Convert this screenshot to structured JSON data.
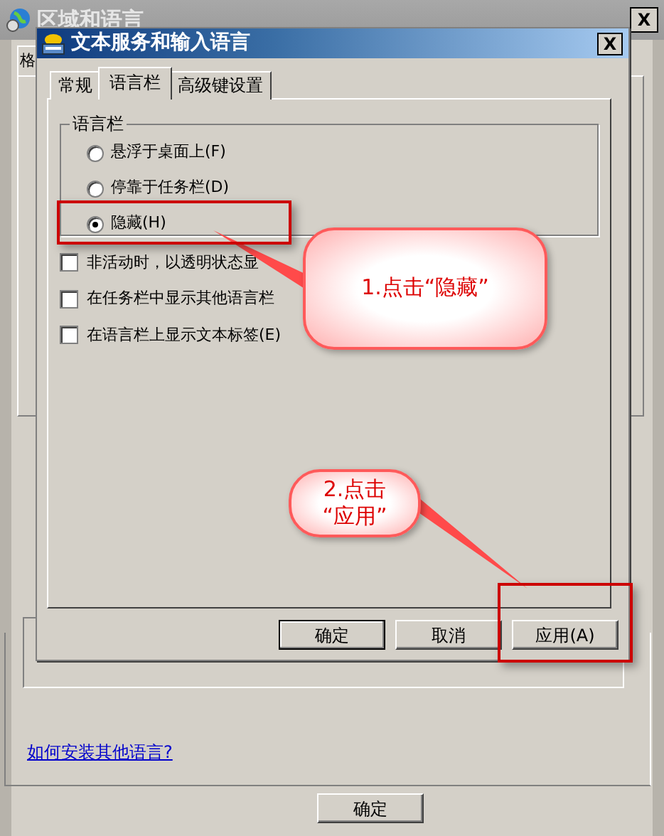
{
  "back_window": {
    "title": "区域和语言",
    "close": "X",
    "tab_fragment": "格",
    "link": "如何安装其他语言?",
    "buttons": [
      {
        "label": "确定"
      }
    ]
  },
  "dialog": {
    "title": "文本服务和输入语言",
    "close": "X",
    "tabs": [
      {
        "label": "常规",
        "selected": false
      },
      {
        "label": "语言栏",
        "selected": true
      },
      {
        "label": "高级键设置",
        "selected": false
      }
    ],
    "group": {
      "title": "语言栏",
      "options": [
        {
          "label": "悬浮于桌面上(F)",
          "selected": false
        },
        {
          "label": "停靠于任务栏(D)",
          "selected": false
        },
        {
          "label": "隐藏(H)",
          "selected": true
        }
      ]
    },
    "checkboxes": [
      {
        "label": "非活动时，以透明状态显",
        "checked": false
      },
      {
        "label": "在任务栏中显示其他语言栏",
        "checked": false
      },
      {
        "label": "在语言栏上显示文本标签(E)",
        "checked": false
      }
    ],
    "buttons": [
      {
        "label": "确定",
        "default": true
      },
      {
        "label": "取消",
        "default": false
      },
      {
        "label": "应用(A)",
        "default": false
      }
    ]
  },
  "annotations": [
    {
      "lines": [
        "1.点击“隐藏”"
      ]
    },
    {
      "lines": [
        "2.点击",
        "“应用”"
      ]
    }
  ]
}
